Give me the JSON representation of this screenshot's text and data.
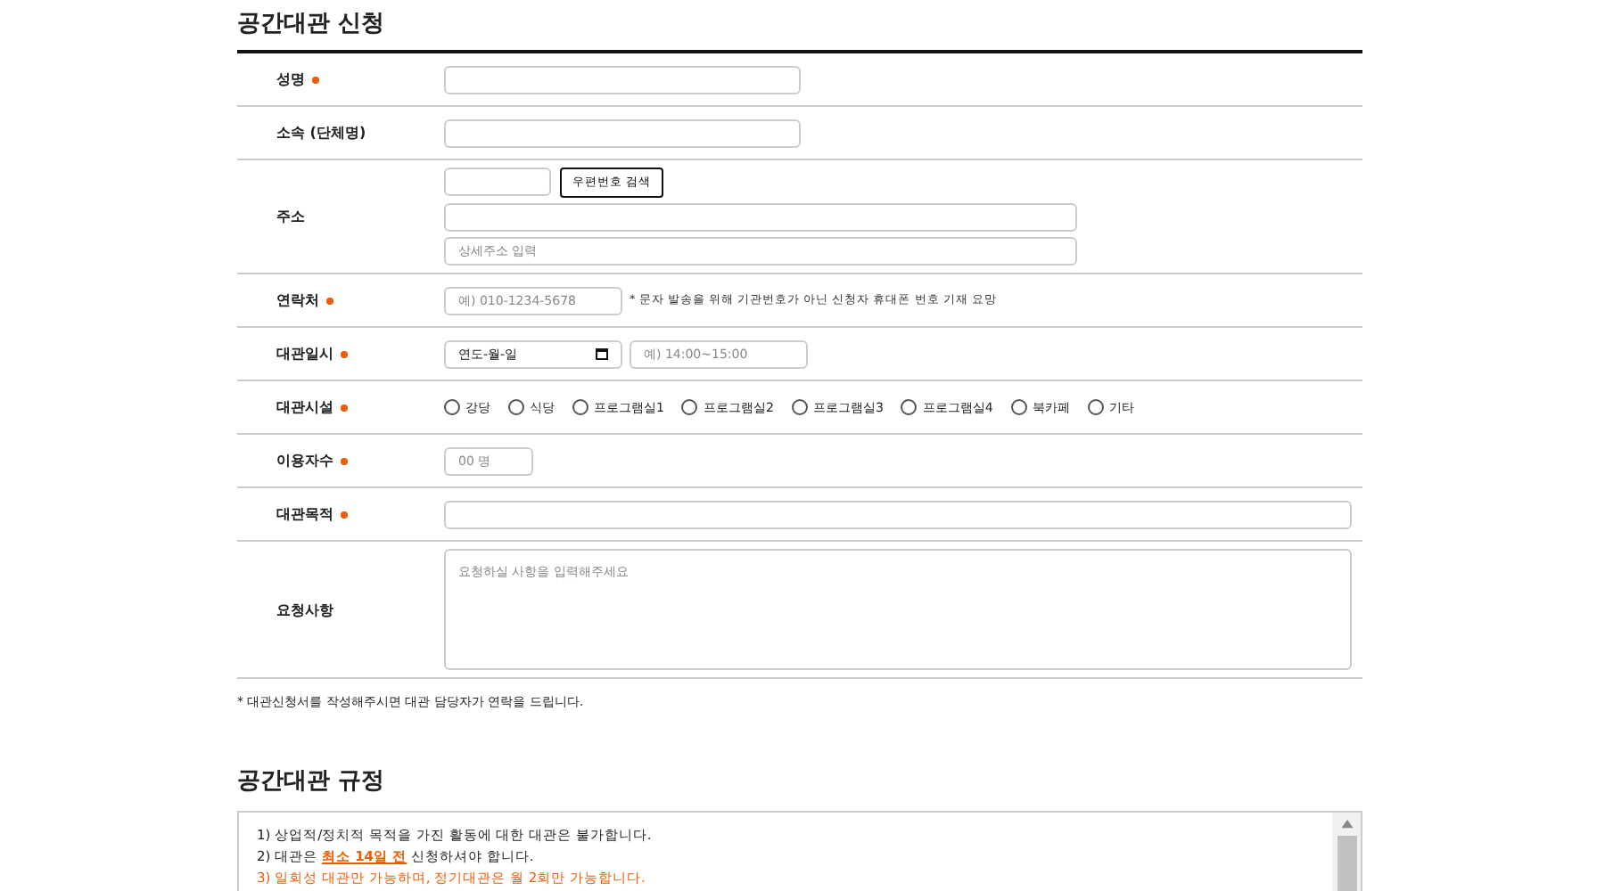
{
  "application": {
    "title": "공간대관 신청",
    "rows": [
      {
        "label": "성명",
        "required": true,
        "kind": "text",
        "fields": [
          {
            "kind": "medium"
          }
        ]
      },
      {
        "label": "소속 (단체명)",
        "required": false,
        "kind": "text",
        "fields": [
          {
            "kind": "medium"
          }
        ]
      },
      {
        "label": "주소",
        "required": false,
        "kind": "address",
        "fields": [
          {
            "kind": "zip"
          },
          {
            "kind": "button",
            "label": "우편번호 검색"
          },
          {
            "kind": "wide"
          },
          {
            "kind": "wide",
            "placeholder": "상세주소 입력"
          }
        ]
      },
      {
        "label": "연락처",
        "required": true,
        "kind": "text",
        "fields": [
          {
            "kind": "contact",
            "placeholder": "예) 010-1234-5678"
          },
          {
            "kind": "note",
            "text": "* 문자 발송을 위해 기관번호가 아닌 신청자 휴대폰 번호 기재 요망"
          }
        ]
      },
      {
        "label": "대관일시",
        "required": true,
        "kind": "text",
        "fields": [
          {
            "kind": "date",
            "value": "연도-월-일"
          },
          {
            "kind": "time",
            "placeholder": "예) 14:00~15:00"
          }
        ]
      },
      {
        "label": "대관시설",
        "required": true,
        "kind": "radios",
        "options": [
          {
            "label": "강당",
            "selected": false
          },
          {
            "label": "식당",
            "selected": false
          },
          {
            "label": "프로그램실1",
            "selected": false
          },
          {
            "label": "프로그램실2",
            "selected": false
          },
          {
            "label": "프로그램실3",
            "selected": false
          },
          {
            "label": "프로그램실4",
            "selected": false
          },
          {
            "label": "북카페",
            "selected": false
          },
          {
            "label": "기타",
            "selected": false
          }
        ]
      },
      {
        "label": "이용자수",
        "required": true,
        "kind": "text",
        "fields": [
          {
            "kind": "count",
            "placeholder": "00 명"
          }
        ]
      },
      {
        "label": "대관목적",
        "required": true,
        "kind": "text",
        "fields": [
          {
            "kind": "full"
          }
        ]
      },
      {
        "label": "요청사항",
        "required": false,
        "kind": "text",
        "fields": [
          {
            "kind": "textarea",
            "placeholder": "요청하실 사항을 입력해주세요"
          }
        ]
      }
    ],
    "footnote": "* 대관신청서를 작성해주시면 대관 담당자가 연락을 드립니다."
  },
  "rules": {
    "title": "공간대관 규정",
    "items": [
      {
        "text": "1) 상업적/정치적 목적을 가진 활동에 대한 대관은 불가합니다.",
        "kind": "normal"
      },
      {
        "text": "2) 대관은 **최소 14일 전** 신청하셔야 합니다.",
        "kind": "normal"
      },
      {
        "text": "3) 일회성 대관만 가능하며, 정기대관은 월 2회만 가능합니다.",
        "kind": "warning"
      }
    ]
  }
}
